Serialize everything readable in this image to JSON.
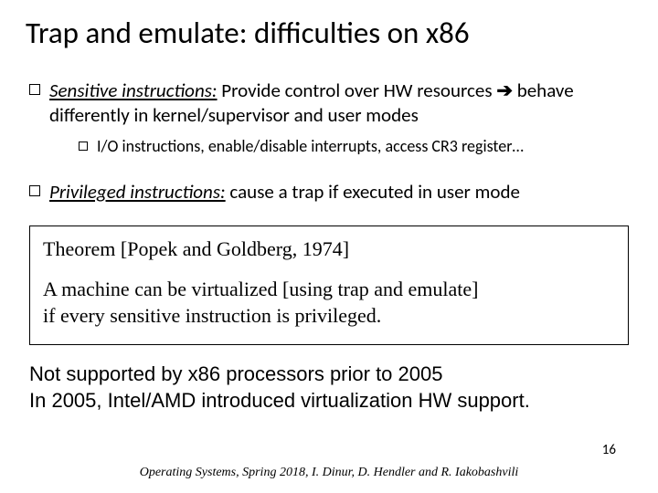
{
  "title": "Trap and emulate: difficulties on x86",
  "bullets": {
    "b1_lead": "Sensitive instructions:",
    "b1_rest": " Provide control over HW resources ",
    "b1_tail": " behave differently in kernel/supervisor and user modes",
    "arrow": "➔",
    "b1a": "I/O instructions, enable/disable interrupts, access CR3 register…",
    "b2_lead": "Privileged instructions:",
    "b2_rest": " cause a trap if executed in user mode"
  },
  "theorem": {
    "heading": "Theorem [Popek and Goldberg, 1974]",
    "line1": "A machine can be virtualized [using trap and emulate]",
    "line2": "if every sensitive instruction is privileged."
  },
  "note": {
    "line1": "Not supported by x86 processors prior to 2005",
    "line2": "In 2005, Intel/AMD introduced virtualization HW support."
  },
  "footer": "Operating Systems, Spring 2018, I. Dinur, D. Hendler and R. Iakobashvili",
  "page": "16"
}
